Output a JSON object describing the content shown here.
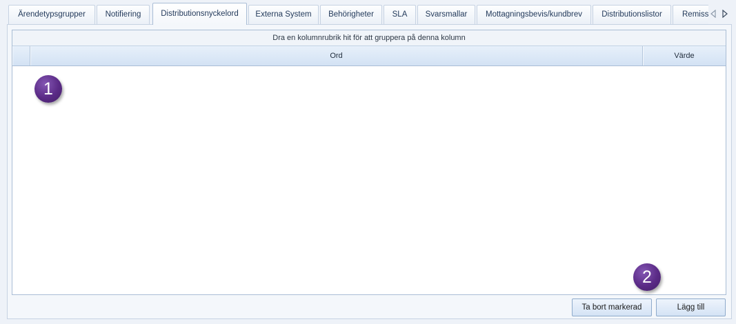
{
  "tabs": {
    "items": [
      {
        "label": "Ärendetypsgrupper",
        "active": false
      },
      {
        "label": "Notifiering",
        "active": false
      },
      {
        "label": "Distributionsnyckelord",
        "active": true
      },
      {
        "label": "Externa System",
        "active": false
      },
      {
        "label": "Behörigheter",
        "active": false
      },
      {
        "label": "SLA",
        "active": false
      },
      {
        "label": "Svarsmallar",
        "active": false
      },
      {
        "label": "Mottagningsbevis/kundbrev",
        "active": false
      },
      {
        "label": "Distributionslistor",
        "active": false
      },
      {
        "label": "Remiss",
        "active": false
      }
    ],
    "icons": {
      "scroll_left": "triangle-left-outline",
      "scroll_right": "triangle-right-outline"
    }
  },
  "grid": {
    "group_panel_text": "Dra en kolumnrubrik hit för att gruppera på denna kolumn",
    "columns": [
      "Ord",
      "Värde"
    ],
    "rows": []
  },
  "buttons": {
    "remove_selected": "Ta bort markerad",
    "add": "Lägg till"
  },
  "callouts": [
    "1",
    "2"
  ],
  "colors": {
    "page_background": "#eef2f8",
    "panel_background": "#f4f7fb",
    "tab_text": "#233a5b",
    "tab_border": "#c6d2e2",
    "grid_border": "#a9bdd5",
    "button_border": "#8eaacb",
    "callout_badge": "#5a2a86"
  }
}
